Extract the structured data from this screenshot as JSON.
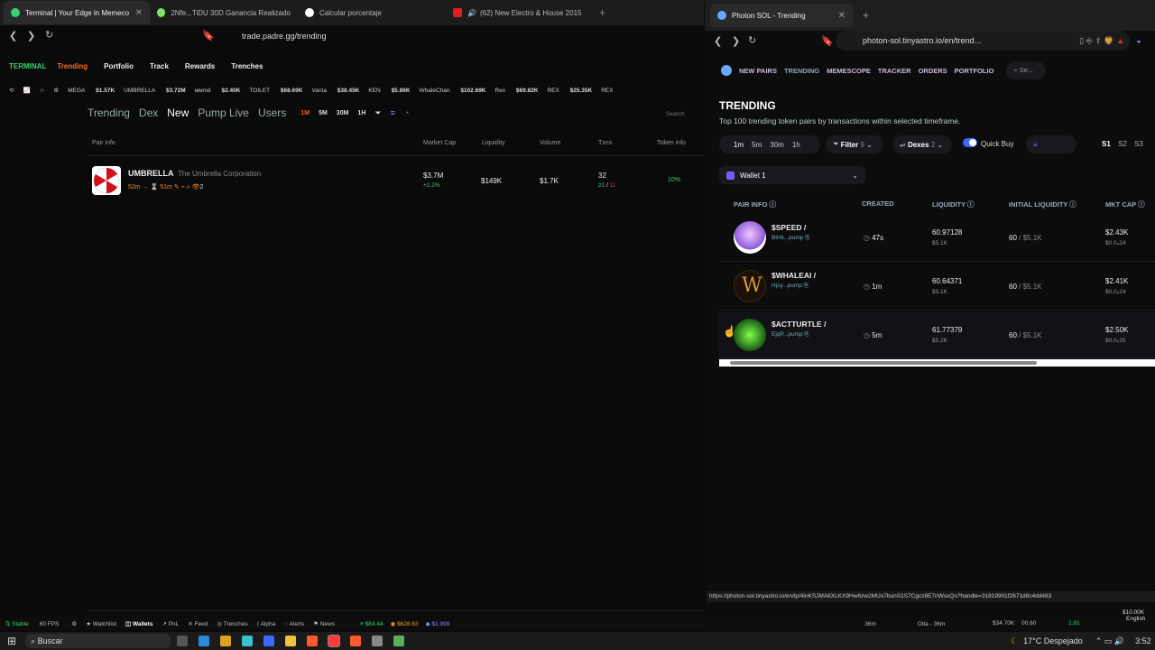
{
  "left_browser": {
    "tabs": [
      {
        "title": "Terminal | Your Edge in Memeco",
        "color": "#3bd16f"
      },
      {
        "title": "2Nfe...TiDU 30D Ganancia Realizado",
        "color": "#7ee36a"
      },
      {
        "title": "Calcular porcentaje",
        "color": "#ffffff"
      },
      {
        "title": "(62) New Electro & House 2015",
        "color": "#e02020"
      }
    ],
    "url": "trade.padre.gg/trending"
  },
  "padre": {
    "logo": "TERMINAL",
    "nav": [
      "Trending",
      "Portfolio",
      "Track",
      "Rewards",
      "Trenches"
    ],
    "ticker": [
      {
        "name": "MEGA",
        "value": "$1.57K"
      },
      {
        "name": "UMBRELLA",
        "value": "$3.72M"
      },
      {
        "name": "ммmё",
        "value": "$2.40K"
      },
      {
        "name": "TOILET",
        "value": "$68.69K"
      },
      {
        "name": "Vanta",
        "value": "$38.45K"
      },
      {
        "name": "KEN",
        "value": "$5.86K"
      },
      {
        "name": "WhaleChan",
        "value": "$102.69K"
      },
      {
        "name": "Rex",
        "value": "$69.82K"
      },
      {
        "name": "REX",
        "value": "$25.35K"
      },
      {
        "name": "REX",
        "value": ""
      }
    ],
    "subtabs": [
      "Trending",
      "Dex",
      "New",
      "Pump Live",
      "Users"
    ],
    "timeframes": [
      "1M",
      "5M",
      "30M",
      "1H"
    ],
    "search_placeholder": "Search",
    "columns": [
      "Pair info",
      "Market Cap",
      "Liquidity",
      "Volume",
      "Txns",
      "Token info"
    ],
    "row": {
      "symbol": "UMBRELLA",
      "name": "The Umbrella Corporation",
      "age": "52m",
      "age2": "51m",
      "holders": "2",
      "mcap": "$3.7M",
      "mcap_change": "+2.2%",
      "liquidity": "$149K",
      "volume": "$1.7K",
      "txns": "32",
      "buys": "21",
      "sells": "11",
      "token_pct": "10%"
    }
  },
  "right_browser": {
    "tab_title": "Photon SOL - Trending",
    "url": "photon-sol.tinyastro.io/en/trend..."
  },
  "photon": {
    "nav": [
      "NEW PAIRS",
      "TRENDING",
      "MEMESCOPE",
      "TRACKER",
      "ORDERS",
      "PORTFOLIO"
    ],
    "search_placeholder": "Se...",
    "title": "TRENDING",
    "subtitle": "Top 100 trending token pairs by transactions within selected timeframe.",
    "timeframes": [
      "1m",
      "5m",
      "30m",
      "1h"
    ],
    "filter_label": "Filter",
    "filter_count": "9",
    "dexes_label": "Dexes",
    "dexes_count": "2",
    "quick_buy": "Quick Buy",
    "presets": [
      "S1",
      "S2",
      "S3"
    ],
    "wallet": "Wallet 1",
    "columns": [
      "PAIR INFO",
      "CREATED",
      "LIQUIDITY",
      "INITIAL LIQUIDITY",
      "MKT CAP"
    ],
    "rows": [
      {
        "symbol": "$SPEED /",
        "addr": "BiHk...pump",
        "created": "47s",
        "liq": "60.97128",
        "liq_usd": "$5.1K",
        "init": "60",
        "init_usd": "$5.1K",
        "mcap": "$2.43K",
        "mcap_sub": "$0.0₅24"
      },
      {
        "symbol": "$WHALEAI /",
        "addr": "Hjsy...pump",
        "created": "1m",
        "liq": "60.64371",
        "liq_usd": "$5.1K",
        "init": "60",
        "init_usd": "$5.1K",
        "mcap": "$2.41K",
        "mcap_sub": "$0.0₅24"
      },
      {
        "symbol": "$ACTTURTLE /",
        "addr": "EjqP...pump",
        "created": "5m",
        "liq": "61.77379",
        "liq_usd": "$5.2K",
        "init": "60",
        "init_usd": "$5.1K",
        "mcap": "$2.50K",
        "mcap_sub": "$0.0₅25"
      }
    ]
  },
  "status_url": "https://photon-sol.tinyastro.io/en/lp/4inKSJMA6XLKX9Hw6zw2MUo7bunS1S7Cgcz8E7nWsxQo?handle=31819901f2671d8c4dd483",
  "bottom": {
    "stable": "Stable",
    "fps": "60 FPS",
    "items": [
      "Watchlist",
      "Wallets",
      "PnL",
      "Feed",
      "Trenches",
      "Alpha",
      "Alerts",
      "News"
    ],
    "prices": [
      "$84.44",
      "$628.63",
      "$1,999"
    ],
    "right": [
      "36m",
      "Otla - 36m",
      "$34.70K",
      "00,60",
      "1.81",
      "$10.00K",
      "English"
    ]
  },
  "taskbar": {
    "search": "Buscar",
    "weather": "17°C  Despejado",
    "time": "3:52"
  }
}
